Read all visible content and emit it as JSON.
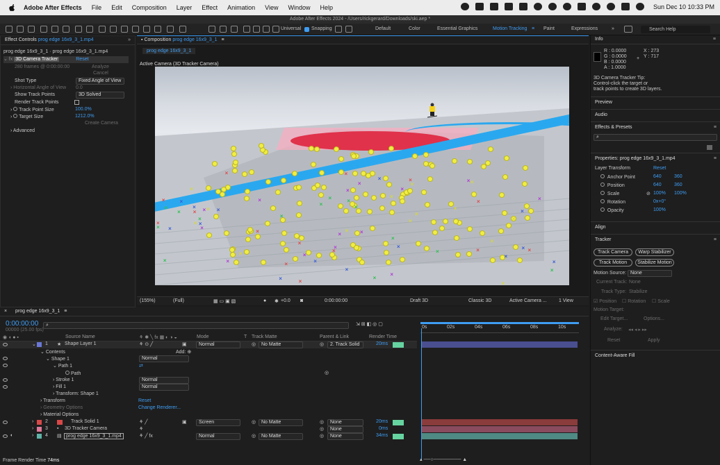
{
  "menubar": {
    "app_name": "Adobe After Effects",
    "menus": [
      "File",
      "Edit",
      "Composition",
      "Layer",
      "Effect",
      "Animation",
      "View",
      "Window",
      "Help"
    ],
    "clock": "Sun Dec 10  10:33 PM"
  },
  "window_title": "Adobe After Effects 2024 - /Users/rickgerard/Downloads/ski.aep *",
  "toolbar": {
    "universal": "Universal",
    "snapping": "Snapping",
    "workspaces": [
      "Default",
      "Color",
      "Essential Graphics",
      "Motion Tracking",
      "Paint",
      "Expressions"
    ],
    "active_workspace": "Motion Tracking",
    "search_placeholder": "Search Help"
  },
  "effect_controls": {
    "tab_label": "Effect Controls",
    "tab_layer": "prog edge 16x9_3_1.mp4",
    "breadcrumb": "prog edge 16x9_3_1 · prog edge 16x9_3_1.mp4",
    "effect_name": "3D Camera Tracker",
    "reset": "Reset",
    "frames_info": "280 frames @ 0:00:00:00",
    "analyze": "Analyze",
    "cancel": "Cancel",
    "shot_type_label": "Shot Type",
    "shot_type_value": "Fixed Angle of View",
    "haov_label": "Horizontal Angle of View",
    "haov_value": "0.0",
    "show_track_points_label": "Show Track Points",
    "show_track_points_value": "3D Solved",
    "render_track_points_label": "Render Track Points",
    "track_point_size_label": "Track Point Size",
    "track_point_size_value": "100.0%",
    "target_size_label": "Target Size",
    "target_size_value": "1212.0%",
    "create_camera": "Create Camera",
    "advanced": "Advanced"
  },
  "composition": {
    "tab_label": "Composition",
    "tab_name": "prog edge 16x9_3_1",
    "subtab": "prog edge 16x9_3_1",
    "viewer_label": "Active Camera (3D Tracker Camera)",
    "zoom": "(155%)",
    "resolution": "(Full)",
    "exposure": "+0.0",
    "timecode": "0:00:00:00",
    "draft": "Draft 3D",
    "renderer": "Classic 3D",
    "camera": "Active Camera ...",
    "views": "1 View"
  },
  "timeline": {
    "comp_name": "prog edge 16x9_3_1",
    "timecode": "0:00:00:00",
    "fps": "00000 (25.00 fps)",
    "columns": {
      "source": "Source Name",
      "mode": "Mode",
      "t": "T",
      "trkmat": "Track Matte",
      "parent": "Parent & Link",
      "render": "Render Time"
    },
    "ruler": [
      "0s",
      "02s",
      "04s",
      "06s",
      "08s",
      "10s"
    ],
    "layers": [
      {
        "num": "1",
        "name": "Shape Layer 1",
        "mode": "Normal",
        "matte": "No Matte",
        "parent": "2. Track Solid",
        "render": "20ms",
        "color": "#6b78d6",
        "bar": "#4a4f8f"
      },
      {
        "num": "2",
        "name": "Track Solid 1",
        "mode": "Screen",
        "matte": "No Matte",
        "parent": "None",
        "render": "20ms",
        "color": "#d94848",
        "bar": "#8a3b3b"
      },
      {
        "num": "3",
        "name": "3D Tracker Camera",
        "mode": "",
        "matte": "",
        "parent": "None",
        "render": "0ms",
        "color": "#e07a9a",
        "bar": "#8a4b5e"
      },
      {
        "num": "4",
        "name": "prog edge 16x9_3_1.mp4",
        "mode": "Normal",
        "matte": "No Matte",
        "parent": "None",
        "render": "34ms",
        "color": "#5fb3a8",
        "bar": "#4f8a84"
      }
    ],
    "props": {
      "contents": "Contents",
      "add": "Add:",
      "shape1": "Shape 1",
      "shape1_mode": "Normal",
      "path1": "Path 1",
      "path": "Path",
      "stroke1": "Stroke 1",
      "stroke1_mode": "Normal",
      "fill1": "Fill 1",
      "fill1_mode": "Normal",
      "transform_shape": "Transform: Shape 1",
      "transform": "Transform",
      "transform_reset": "Reset",
      "geometry": "Geometry Options",
      "change_renderer": "Change Renderer...",
      "material": "Material Options"
    },
    "frame_render_label": "Frame Render Time",
    "frame_render_value": "74ms"
  },
  "info_panel": {
    "title": "Info",
    "r": "R : 0.0000",
    "g": "G : 0.0000",
    "b": "B : 0.0000",
    "a": "A : 1.0000",
    "x": "X : 273",
    "y": "Y : 717",
    "tip_title": "3D Camera Tracker Tip:",
    "tip_line1": "Control-click the target or",
    "tip_line2": "track points to create 3D layers."
  },
  "right_panels": {
    "preview": "Preview",
    "audio": "Audio",
    "effects_presets": "Effects & Presets",
    "search_placeholder": "",
    "properties_title": "Properties: prog edge 16x9_3_1.mp4",
    "layer_transform": "Layer Transform",
    "reset": "Reset",
    "anchor_label": "Anchor Point",
    "anchor_x": "640",
    "anchor_y": "360",
    "position_label": "Position",
    "position_x": "640",
    "position_y": "360",
    "scale_label": "Scale",
    "scale_x": "100%",
    "scale_y": "100%",
    "rotation_label": "Rotation",
    "rotation_value": "0x+0°",
    "opacity_label": "Opacity",
    "opacity_value": "100%",
    "align": "Align",
    "tracker": "Tracker",
    "track_camera": "Track Camera",
    "warp_stabilizer": "Warp Stabilizer",
    "track_motion": "Track Motion",
    "stabilize_motion": "Stabilize Motion",
    "motion_source_label": "Motion Source:",
    "motion_source_value": "None",
    "current_track_label": "Current Track:",
    "current_track_value": "None",
    "track_type_label": "Track Type:",
    "track_type_value": "Stabilize",
    "cb_position": "Position",
    "cb_rotation": "Rotation",
    "cb_scale": "Scale",
    "motion_target": "Motion Target:",
    "edit_target": "Edit Target...",
    "options": "Options...",
    "analyze": "Analyze:",
    "reset_btn": "Reset",
    "apply_btn": "Apply",
    "content_aware_fill": "Content-Aware Fill"
  }
}
